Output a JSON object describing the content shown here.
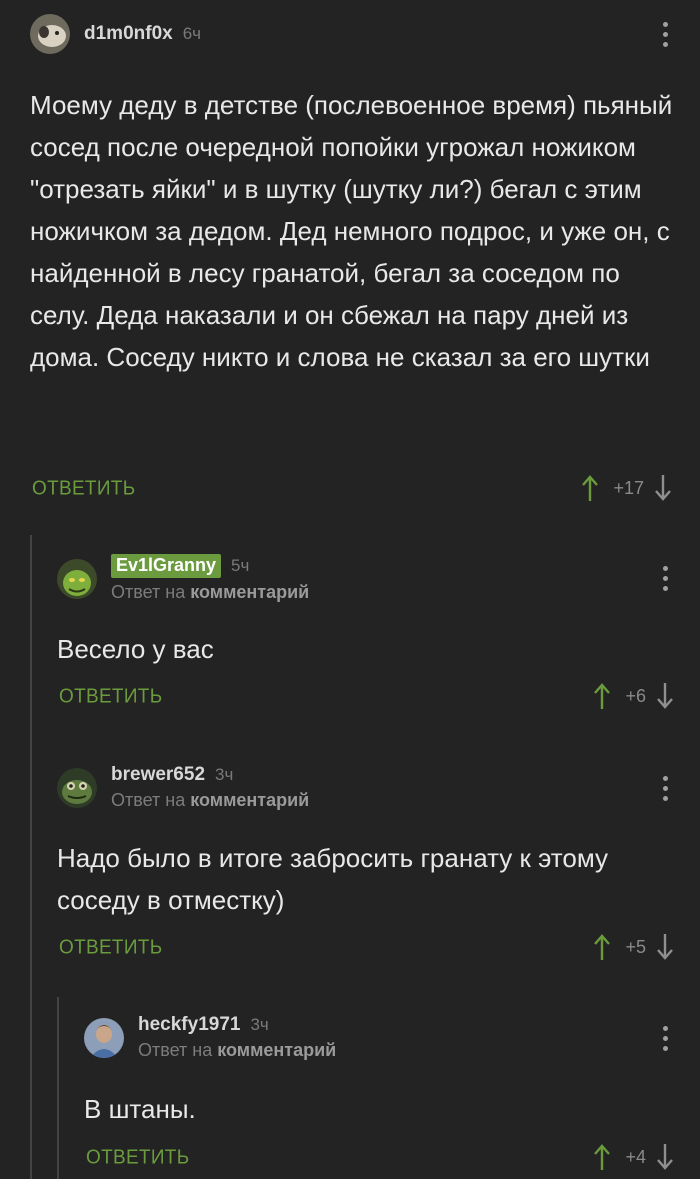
{
  "comments": [
    {
      "username": "d1m0nf0x",
      "time": "6ч",
      "text": "Моему деду в детстве (послевоенное время) пьяный сосед после очередной попойки угрожал ножиком \"отрезать яйки\" и в шутку (шутку ли?) бегал с этим ножичком за дедом. Дед немного подрос, и уже он, с найденной в лесу гранатой, бегал за соседом по селу. Деда наказали и он сбежал на пару дней из дома. Соседу никто и слова не сказал за его шутки",
      "reply_label": "ОТВЕТИТЬ",
      "score": "+17"
    },
    {
      "username": "Ev1lGranny",
      "time": "5ч",
      "reply_prefix": "Ответ на",
      "reply_target": "комментарий",
      "text": "Весело у вас",
      "reply_label": "ОТВЕТИТЬ",
      "score": "+6"
    },
    {
      "username": "brewer652",
      "time": "3ч",
      "reply_prefix": "Ответ на",
      "reply_target": "комментарий",
      "text": "Надо было в итоге забросить гранату к этому соседу в отместку)",
      "reply_label": "ОТВЕТИТЬ",
      "score": "+5"
    },
    {
      "username": "heckfy1971",
      "time": "3ч",
      "reply_prefix": "Ответ на",
      "reply_target": "комментарий",
      "text": "В штаны.",
      "reply_label": "ОТВЕТИТЬ",
      "score": "+4"
    }
  ],
  "colors": {
    "background": "#232323",
    "accent_green": "#6a9c3e",
    "badge_green": "#6b9a3f",
    "thread_line": "#444444"
  },
  "icons": [
    "more-vertical-icon",
    "upvote-arrow-icon",
    "downvote-arrow-icon"
  ]
}
